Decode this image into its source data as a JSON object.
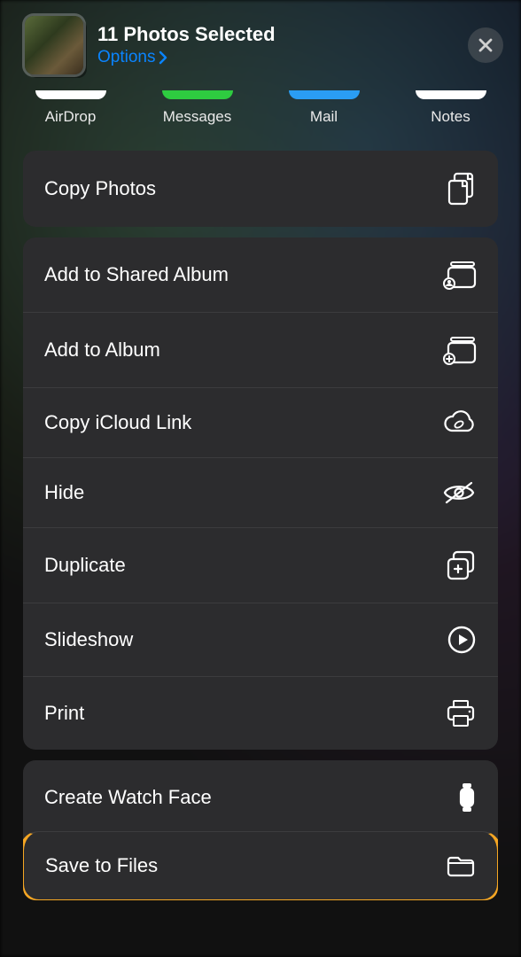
{
  "header": {
    "title": "11 Photos Selected",
    "options_label": "Options"
  },
  "apps": [
    {
      "label": "AirDrop"
    },
    {
      "label": "Messages"
    },
    {
      "label": "Mail"
    },
    {
      "label": "Notes"
    }
  ],
  "group1": [
    {
      "label": "Copy Photos",
      "icon": "copy-doc"
    }
  ],
  "group2": [
    {
      "label": "Add to Shared Album",
      "icon": "shared-album"
    },
    {
      "label": "Add to Album",
      "icon": "add-album"
    },
    {
      "label": "Copy iCloud Link",
      "icon": "cloud-link"
    },
    {
      "label": "Hide",
      "icon": "eye-slash"
    },
    {
      "label": "Duplicate",
      "icon": "duplicate"
    },
    {
      "label": "Slideshow",
      "icon": "play-circle"
    },
    {
      "label": "Print",
      "icon": "printer"
    }
  ],
  "group3": [
    {
      "label": "Create Watch Face",
      "icon": "watch"
    },
    {
      "label": "Save to Files",
      "icon": "folder",
      "highlighted": true
    }
  ],
  "colors": {
    "accent": "#0a84ff",
    "highlight": "#f5a623",
    "panel": "#2c2c2e"
  }
}
